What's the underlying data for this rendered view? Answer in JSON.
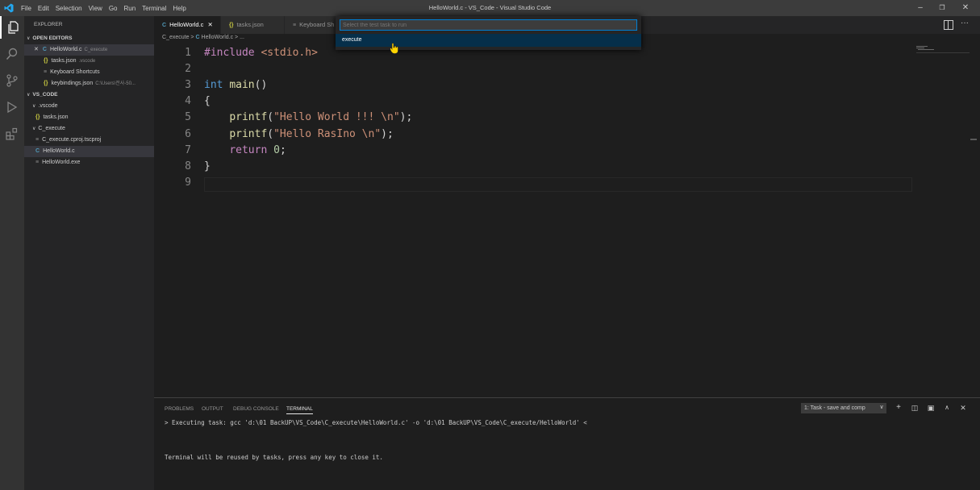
{
  "window": {
    "title": "HelloWorld.c - VS_Code - Visual Studio Code",
    "menu": [
      "File",
      "Edit",
      "Selection",
      "View",
      "Go",
      "Run",
      "Terminal",
      "Help"
    ]
  },
  "sidebar": {
    "explorer_title": "EXPLORER",
    "open_editors_title": "OPEN EDITORS",
    "open_editors": [
      {
        "name": "HelloWorld.c",
        "detail": "C_execute",
        "icon": "c-file-icon"
      },
      {
        "name": "tasks.json",
        "detail": ".vscode",
        "icon": "json-file-icon"
      },
      {
        "name": "Keyboard Shortcuts",
        "detail": "",
        "icon": "list-icon"
      },
      {
        "name": "keybindings.json",
        "detail": "C:\\Users\\전사-50...",
        "icon": "json-file-icon"
      }
    ],
    "folder_title": "VS_CODE",
    "tree": [
      {
        "name": ".vscode",
        "type": "folder"
      },
      {
        "name": "tasks.json",
        "type": "json"
      },
      {
        "name": "C_execute",
        "type": "folder"
      },
      {
        "name": "C_execute.cproj.tscproj",
        "type": "file"
      },
      {
        "name": "HelloWorld.c",
        "type": "c"
      },
      {
        "name": "HelloWorld.exe",
        "type": "file"
      }
    ]
  },
  "tabs": [
    {
      "label": "HelloWorld.c",
      "icon": "C",
      "active": true
    },
    {
      "label": "tasks.json",
      "icon": "{}",
      "active": false
    },
    {
      "label": "Keyboard Sh",
      "icon": "≡",
      "active": false
    }
  ],
  "breadcrumb": {
    "folder": "C_execute",
    "file": "HelloWorld.c",
    "rest": "..."
  },
  "editor": {
    "line_numbers": [
      "1",
      "2",
      "3",
      "4",
      "5",
      "6",
      "7",
      "8",
      "9"
    ],
    "lines": [
      {
        "include_kw": "#include",
        "header": "<stdio.h>"
      },
      {},
      {
        "type": "int",
        "fn": "main",
        "rest": "()"
      },
      {
        "text": "{"
      },
      {
        "fn": "printf",
        "str": "\"Hello World !!! \\n\"",
        "end": ");"
      },
      {
        "fn": "printf",
        "str": "\"Hello RasIno \\n\"",
        "end": ");"
      },
      {
        "kw": "return",
        "num": "0",
        "end": ";"
      },
      {
        "text": "}"
      },
      {}
    ]
  },
  "quick_pick": {
    "placeholder": "Select the test task to run",
    "items": [
      "execute"
    ]
  },
  "panel": {
    "tabs": [
      "PROBLEMS",
      "OUTPUT",
      "DEBUG CONSOLE",
      "TERMINAL"
    ],
    "terminal_select": "1: Task - save and comp",
    "terminal_lines": [
      "> Executing task: gcc 'd:\\01 BackUP\\VS_Code\\C_execute\\HelloWorld.c' -o 'd:\\01 BackUP\\VS_Code\\C_execute/HelloWorld' <",
      "Terminal will be reused by tasks, press any key to close it."
    ]
  },
  "colors": {
    "accent": "#007acc",
    "selection": "#062f4a"
  }
}
